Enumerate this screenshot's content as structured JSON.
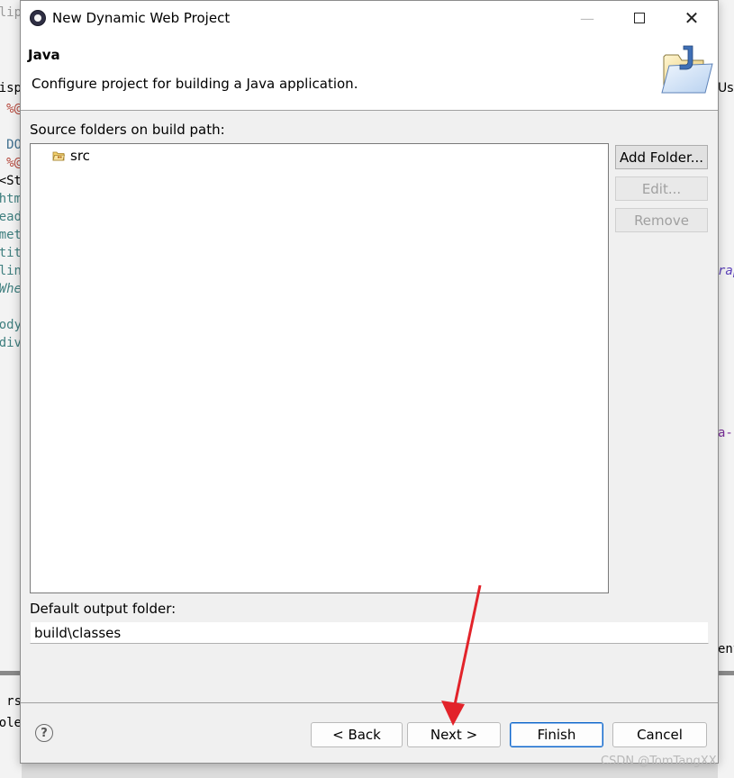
{
  "background": {
    "left_fragments": [
      "clip",
      "isp",
      "%@",
      "DO",
      "%@",
      "<St",
      "htm",
      "head",
      "met",
      "tit",
      "lin",
      "Whe",
      "body",
      "div",
      "rs",
      "ole"
    ],
    "right_fragments": [
      "Us",
      "rap",
      "a-",
      "ent"
    ]
  },
  "window": {
    "title": "New Dynamic Web Project",
    "minimize_glyph": "—",
    "close_glyph": "✕"
  },
  "banner": {
    "title": "Java",
    "description": "Configure project for building a Java application."
  },
  "source_folders": {
    "label": "Source folders on build path:",
    "items": [
      "src"
    ]
  },
  "side_buttons": {
    "add_folder": "Add Folder...",
    "edit": "Edit...",
    "remove": "Remove"
  },
  "output_folder": {
    "label": "Default output folder:",
    "value": "build\\classes"
  },
  "footer": {
    "help_glyph": "?",
    "back": "< Back",
    "next": "Next >",
    "finish": "Finish",
    "cancel": "Cancel"
  },
  "watermark": "CSDN @TomTangXX",
  "colors": {
    "arrow": "#e2232a",
    "default_button_border": "#0a64c8"
  },
  "icons": {
    "app": "eclipse-icon",
    "banner": "java-folder-wizard-icon",
    "tree_item": "package-folder-icon",
    "help": "help-icon"
  }
}
